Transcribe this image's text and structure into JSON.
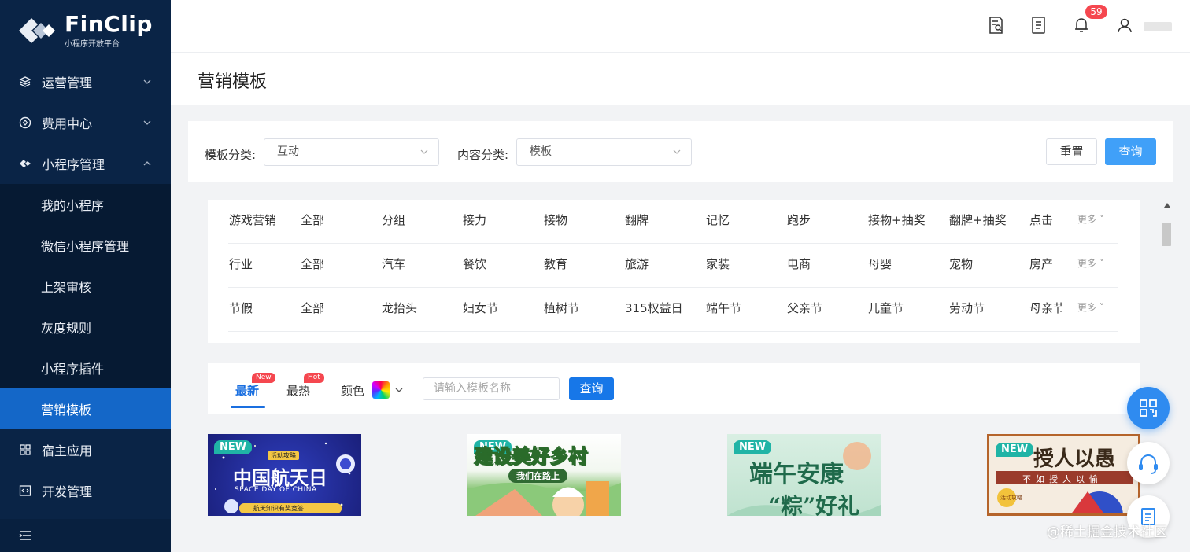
{
  "brand": {
    "name": "FinClip",
    "subtitle": "小程序开放平台"
  },
  "sidebar": {
    "groups": [
      {
        "label": "运营管理"
      },
      {
        "label": "费用中心"
      },
      {
        "label": "小程序管理"
      }
    ],
    "sub_items": [
      {
        "label": "我的小程序"
      },
      {
        "label": "微信小程序管理"
      },
      {
        "label": "上架审核"
      },
      {
        "label": "灰度规则"
      },
      {
        "label": "小程序插件"
      },
      {
        "label": "营销模板"
      }
    ],
    "bottom_items": [
      {
        "label": "宿主应用"
      },
      {
        "label": "开发管理"
      }
    ]
  },
  "topbar": {
    "notification_count": "59"
  },
  "page": {
    "title": "营销模板"
  },
  "filter": {
    "template_label": "模板分类:",
    "template_value": "互动",
    "content_label": "内容分类:",
    "content_value": "模板",
    "reset_label": "重置",
    "query_label": "查询"
  },
  "categories": {
    "more_label": "更多",
    "rows": [
      {
        "head": "游戏营销",
        "items": [
          "全部",
          "分组",
          "接力",
          "接物",
          "翻牌",
          "记忆",
          "跑步",
          "接物+抽奖",
          "翻牌+抽奖",
          "点击"
        ]
      },
      {
        "head": "行业",
        "items": [
          "全部",
          "汽车",
          "餐饮",
          "教育",
          "旅游",
          "家装",
          "电商",
          "母婴",
          "宠物",
          "房产"
        ]
      },
      {
        "head": "节假",
        "items": [
          "全部",
          "龙抬头",
          "妇女节",
          "植树节",
          "315权益日",
          "端午节",
          "父亲节",
          "儿童节",
          "劳动节",
          "母亲节"
        ]
      }
    ]
  },
  "tabs": {
    "newest": "最新",
    "newest_tag": "New",
    "hottest": "最热",
    "hottest_tag": "Hot",
    "color_label": "颜色",
    "search_placeholder": "请输入模板名称",
    "search_button": "查询"
  },
  "templates": [
    {
      "badge": "NEW",
      "title": "中国航天日",
      "top_label": "活动攻略",
      "subtitle": "SPACE DAY OF CHINA",
      "caption": "航天知识有奖竞答"
    },
    {
      "badge": "NEW",
      "title": "建设美好乡村",
      "subtitle": "我们在路上"
    },
    {
      "badge": "NEW",
      "title": "端午安康",
      "subtitle": "“粽”好礼"
    },
    {
      "badge": "NEW",
      "title": "授人以愚",
      "subtitle": "不如授人以愉",
      "stamp": "活动攻略"
    }
  ],
  "watermark": "@稀土掘金技术社区",
  "colors": {
    "sidebar": "#0a2446",
    "active": "#1467c8",
    "primary": "#1777e8",
    "badge": "#f5474f"
  }
}
